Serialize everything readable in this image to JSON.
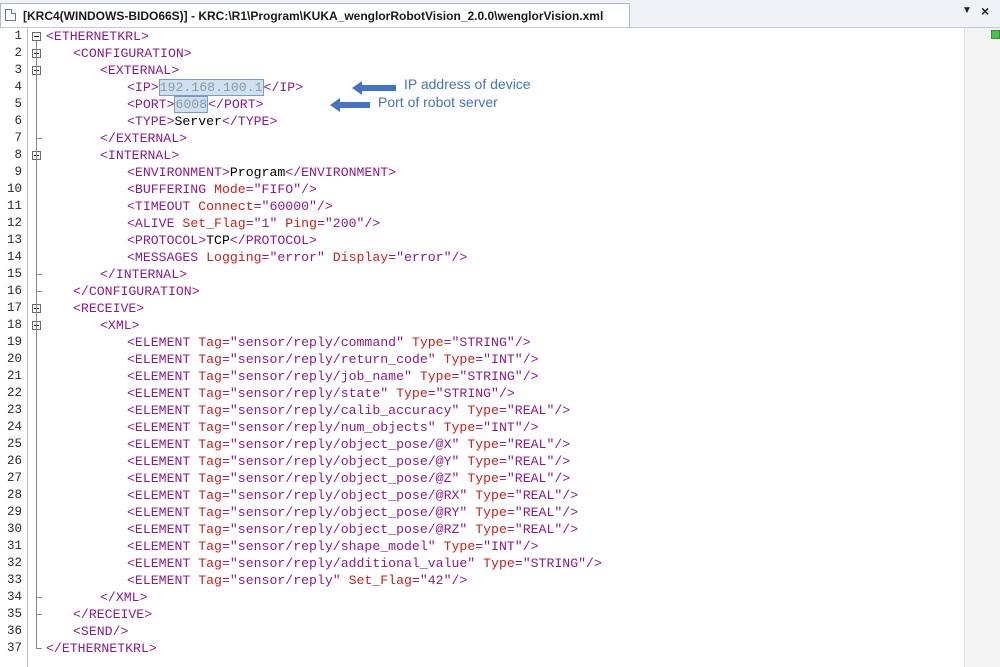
{
  "tab": {
    "title": "[KRC4(WINDOWS-BIDO66S)] - KRC:\\R1\\Program\\KUKA_wenglorRobotVision_2.0.0\\wenglorVision.xml",
    "dropdown_icon": "chevron-down-icon",
    "close_label": "×"
  },
  "editor": {
    "colors": {
      "tag": "#8b1a8b",
      "attribute": "#c8201e",
      "value": "#8b1a8b",
      "text": "#000000",
      "selection": "#cfe0f2"
    },
    "line_numbers": [
      "1",
      "2",
      "3",
      "4",
      "5",
      "6",
      "7",
      "8",
      "9",
      "10",
      "11",
      "12",
      "13",
      "14",
      "15",
      "16",
      "17",
      "18",
      "19",
      "20",
      "21",
      "22",
      "23",
      "24",
      "25",
      "26",
      "27",
      "28",
      "29",
      "30",
      "31",
      "32",
      "33",
      "34",
      "35",
      "36",
      "37"
    ],
    "lines": [
      {
        "indent": 0,
        "segs": [
          [
            "t",
            "<ETHERNETKRL>"
          ]
        ]
      },
      {
        "indent": 1,
        "segs": [
          [
            "t",
            "<CONFIGURATION>"
          ]
        ]
      },
      {
        "indent": 2,
        "segs": [
          [
            "t",
            "<EXTERNAL>"
          ]
        ]
      },
      {
        "indent": 3,
        "segs": [
          [
            "t",
            "<IP>"
          ],
          [
            "hl",
            "192.168.100.1"
          ],
          [
            "t",
            "</IP>"
          ]
        ]
      },
      {
        "indent": 3,
        "segs": [
          [
            "t",
            "<PORT>"
          ],
          [
            "hl",
            "6008"
          ],
          [
            "t",
            "</PORT>"
          ]
        ]
      },
      {
        "indent": 3,
        "segs": [
          [
            "t",
            "<TYPE>"
          ],
          [
            "x",
            "Server"
          ],
          [
            "t",
            "</TYPE>"
          ]
        ]
      },
      {
        "indent": 2,
        "segs": [
          [
            "t",
            "</EXTERNAL>"
          ]
        ]
      },
      {
        "indent": 2,
        "segs": [
          [
            "t",
            "<INTERNAL>"
          ]
        ]
      },
      {
        "indent": 3,
        "segs": [
          [
            "t",
            "<ENVIRONMENT>"
          ],
          [
            "x",
            "Program"
          ],
          [
            "t",
            "</ENVIRONMENT>"
          ]
        ]
      },
      {
        "indent": 3,
        "segs": [
          [
            "t",
            "<BUFFERING "
          ],
          [
            "a",
            "Mode"
          ],
          [
            "v",
            "=\"FIFO\""
          ],
          [
            "t",
            "/>"
          ]
        ]
      },
      {
        "indent": 3,
        "segs": [
          [
            "t",
            "<TIMEOUT "
          ],
          [
            "a",
            "Connect"
          ],
          [
            "v",
            "=\"60000\""
          ],
          [
            "t",
            "/>"
          ]
        ]
      },
      {
        "indent": 3,
        "segs": [
          [
            "t",
            "<ALIVE "
          ],
          [
            "a",
            "Set_Flag"
          ],
          [
            "v",
            "=\"1\" "
          ],
          [
            "a",
            "Ping"
          ],
          [
            "v",
            "=\"200\""
          ],
          [
            "t",
            "/>"
          ]
        ]
      },
      {
        "indent": 3,
        "segs": [
          [
            "t",
            "<PROTOCOL>"
          ],
          [
            "x",
            "TCP"
          ],
          [
            "t",
            "</PROTOCOL>"
          ]
        ]
      },
      {
        "indent": 3,
        "segs": [
          [
            "t",
            "<MESSAGES "
          ],
          [
            "a",
            "Logging"
          ],
          [
            "v",
            "=\"error\" "
          ],
          [
            "a",
            "Display"
          ],
          [
            "v",
            "=\"error\""
          ],
          [
            "t",
            "/>"
          ]
        ]
      },
      {
        "indent": 2,
        "segs": [
          [
            "t",
            "</INTERNAL>"
          ]
        ]
      },
      {
        "indent": 1,
        "segs": [
          [
            "t",
            "</CONFIGURATION>"
          ]
        ]
      },
      {
        "indent": 1,
        "segs": [
          [
            "t",
            "<RECEIVE>"
          ]
        ]
      },
      {
        "indent": 2,
        "segs": [
          [
            "t",
            "<XML>"
          ]
        ]
      },
      {
        "indent": 3,
        "segs": [
          [
            "t",
            "<ELEMENT "
          ],
          [
            "a",
            "Tag"
          ],
          [
            "v",
            "=\"sensor/reply/command\" "
          ],
          [
            "a",
            "Type"
          ],
          [
            "v",
            "=\"STRING\""
          ],
          [
            "t",
            "/>"
          ]
        ]
      },
      {
        "indent": 3,
        "segs": [
          [
            "t",
            "<ELEMENT "
          ],
          [
            "a",
            "Tag"
          ],
          [
            "v",
            "=\"sensor/reply/return_code\" "
          ],
          [
            "a",
            "Type"
          ],
          [
            "v",
            "=\"INT\""
          ],
          [
            "t",
            "/>"
          ]
        ]
      },
      {
        "indent": 3,
        "segs": [
          [
            "t",
            "<ELEMENT "
          ],
          [
            "a",
            "Tag"
          ],
          [
            "v",
            "=\"sensor/reply/job_name\" "
          ],
          [
            "a",
            "Type"
          ],
          [
            "v",
            "=\"STRING\""
          ],
          [
            "t",
            "/>"
          ]
        ]
      },
      {
        "indent": 3,
        "segs": [
          [
            "t",
            "<ELEMENT "
          ],
          [
            "a",
            "Tag"
          ],
          [
            "v",
            "=\"sensor/reply/state\" "
          ],
          [
            "a",
            "Type"
          ],
          [
            "v",
            "=\"STRING\""
          ],
          [
            "t",
            "/>"
          ]
        ]
      },
      {
        "indent": 3,
        "segs": [
          [
            "t",
            "<ELEMENT "
          ],
          [
            "a",
            "Tag"
          ],
          [
            "v",
            "=\"sensor/reply/calib_accuracy\" "
          ],
          [
            "a",
            "Type"
          ],
          [
            "v",
            "=\"REAL\""
          ],
          [
            "t",
            "/>"
          ]
        ]
      },
      {
        "indent": 3,
        "segs": [
          [
            "t",
            "<ELEMENT "
          ],
          [
            "a",
            "Tag"
          ],
          [
            "v",
            "=\"sensor/reply/num_objects\" "
          ],
          [
            "a",
            "Type"
          ],
          [
            "v",
            "=\"INT\""
          ],
          [
            "t",
            "/>"
          ]
        ]
      },
      {
        "indent": 3,
        "segs": [
          [
            "t",
            "<ELEMENT "
          ],
          [
            "a",
            "Tag"
          ],
          [
            "v",
            "=\"sensor/reply/object_pose/@X\" "
          ],
          [
            "a",
            "Type"
          ],
          [
            "v",
            "=\"REAL\""
          ],
          [
            "t",
            "/>"
          ]
        ]
      },
      {
        "indent": 3,
        "segs": [
          [
            "t",
            "<ELEMENT "
          ],
          [
            "a",
            "Tag"
          ],
          [
            "v",
            "=\"sensor/reply/object_pose/@Y\" "
          ],
          [
            "a",
            "Type"
          ],
          [
            "v",
            "=\"REAL\""
          ],
          [
            "t",
            "/>"
          ]
        ]
      },
      {
        "indent": 3,
        "segs": [
          [
            "t",
            "<ELEMENT "
          ],
          [
            "a",
            "Tag"
          ],
          [
            "v",
            "=\"sensor/reply/object_pose/@Z\" "
          ],
          [
            "a",
            "Type"
          ],
          [
            "v",
            "=\"REAL\""
          ],
          [
            "t",
            "/>"
          ]
        ]
      },
      {
        "indent": 3,
        "segs": [
          [
            "t",
            "<ELEMENT "
          ],
          [
            "a",
            "Tag"
          ],
          [
            "v",
            "=\"sensor/reply/object_pose/@RX\" "
          ],
          [
            "a",
            "Type"
          ],
          [
            "v",
            "=\"REAL\""
          ],
          [
            "t",
            "/>"
          ]
        ]
      },
      {
        "indent": 3,
        "segs": [
          [
            "t",
            "<ELEMENT "
          ],
          [
            "a",
            "Tag"
          ],
          [
            "v",
            "=\"sensor/reply/object_pose/@RY\" "
          ],
          [
            "a",
            "Type"
          ],
          [
            "v",
            "=\"REAL\""
          ],
          [
            "t",
            "/>"
          ]
        ]
      },
      {
        "indent": 3,
        "segs": [
          [
            "t",
            "<ELEMENT "
          ],
          [
            "a",
            "Tag"
          ],
          [
            "v",
            "=\"sensor/reply/object_pose/@RZ\" "
          ],
          [
            "a",
            "Type"
          ],
          [
            "v",
            "=\"REAL\""
          ],
          [
            "t",
            "/>"
          ]
        ]
      },
      {
        "indent": 3,
        "segs": [
          [
            "t",
            "<ELEMENT "
          ],
          [
            "a",
            "Tag"
          ],
          [
            "v",
            "=\"sensor/reply/shape_model\" "
          ],
          [
            "a",
            "Type"
          ],
          [
            "v",
            "=\"INT\""
          ],
          [
            "t",
            "/>"
          ]
        ]
      },
      {
        "indent": 3,
        "segs": [
          [
            "t",
            "<ELEMENT "
          ],
          [
            "a",
            "Tag"
          ],
          [
            "v",
            "=\"sensor/reply/additional_value\" "
          ],
          [
            "a",
            "Type"
          ],
          [
            "v",
            "=\"STRING\""
          ],
          [
            "t",
            "/>"
          ]
        ]
      },
      {
        "indent": 3,
        "segs": [
          [
            "t",
            "<ELEMENT "
          ],
          [
            "a",
            "Tag"
          ],
          [
            "v",
            "=\"sensor/reply\" "
          ],
          [
            "a",
            "Set_Flag"
          ],
          [
            "v",
            "=\"42\""
          ],
          [
            "t",
            "/>"
          ]
        ]
      },
      {
        "indent": 2,
        "segs": [
          [
            "t",
            "</XML>"
          ]
        ]
      },
      {
        "indent": 1,
        "segs": [
          [
            "t",
            "</RECEIVE>"
          ]
        ]
      },
      {
        "indent": 1,
        "segs": [
          [
            "t",
            "<SEND/>"
          ]
        ]
      },
      {
        "indent": 0,
        "segs": [
          [
            "t",
            "</ETHERNETKRL>"
          ]
        ]
      }
    ],
    "fold_lines": [
      1,
      2,
      3,
      8,
      17,
      18
    ],
    "fold_ends": [
      7,
      15,
      16,
      34,
      35,
      37
    ]
  },
  "annotations": {
    "ip": "IP address of device",
    "port": "Port of robot server",
    "color": "#4472c4"
  }
}
